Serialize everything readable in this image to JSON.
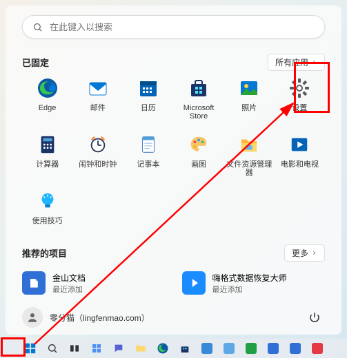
{
  "search": {
    "placeholder": "在此键入以搜索"
  },
  "pinned": {
    "title": "已固定",
    "all_apps": "所有应用",
    "apps": [
      {
        "label": "Edge"
      },
      {
        "label": "邮件"
      },
      {
        "label": "日历"
      },
      {
        "label": "Microsoft Store"
      },
      {
        "label": "照片"
      },
      {
        "label": "设置"
      },
      {
        "label": "计算器"
      },
      {
        "label": "闹钟和时钟"
      },
      {
        "label": "记事本"
      },
      {
        "label": "画图"
      },
      {
        "label": "文件资源管理器"
      },
      {
        "label": "电影和电视"
      },
      {
        "label": "使用技巧"
      }
    ]
  },
  "recommended": {
    "title": "推荐的项目",
    "more": "更多",
    "items": [
      {
        "title": "金山文档",
        "sub": "最近添加"
      },
      {
        "title": "嗨格式数据恢复大师",
        "sub": "最近添加"
      }
    ]
  },
  "user": {
    "name": "零分猫（lingfenmao.com）"
  }
}
